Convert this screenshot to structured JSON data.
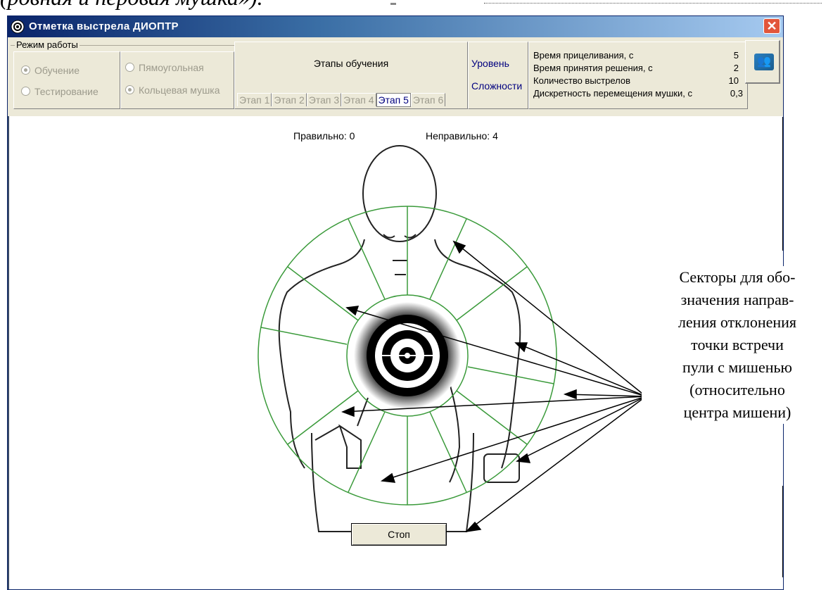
{
  "document": {
    "header_text": "(ровная и перовая мушка»)."
  },
  "window": {
    "title": "Отметка выстрела ДИОПТР"
  },
  "mode": {
    "legend": "Режим работы",
    "learning": "Обучение",
    "testing": "Тестирование",
    "rectangular": "Пямоугольная",
    "ring": "Кольцевая мушка"
  },
  "stages": {
    "title": "Этапы обучения",
    "tabs": [
      "Этап 1",
      "Этап 2",
      "Этап 3",
      "Этап 4",
      "Этап 5",
      "Этап 6"
    ],
    "active": "Этап 5"
  },
  "level": {
    "line1": "Уровень",
    "line2": "Сложности"
  },
  "params": {
    "aim_time_label": "Время прицеливания, с",
    "aim_time_value": "5",
    "decision_time_label": "Время принятия решения, с",
    "decision_time_value": "2",
    "shots_label": "Количество выстрелов",
    "shots_value": "10",
    "step_label": "Дискретность перемещения мушки, с",
    "step_value": "0,3"
  },
  "status": {
    "correct": "Правильно: 0",
    "wrong": "Неправильно: 4"
  },
  "buttons": {
    "stop": "Стоп"
  },
  "annotation": {
    "lines": [
      "Секторы для обо-",
      "значения направ-",
      "ления отклонения",
      "точки встречи",
      "пули с мишенью",
      "(относительно",
      "центра мишени)"
    ]
  },
  "colors": {
    "ring": "#3a9a3a",
    "title_gradient_start": "#0a246a",
    "title_gradient_end": "#a6caf0",
    "close": "#e2563b"
  }
}
